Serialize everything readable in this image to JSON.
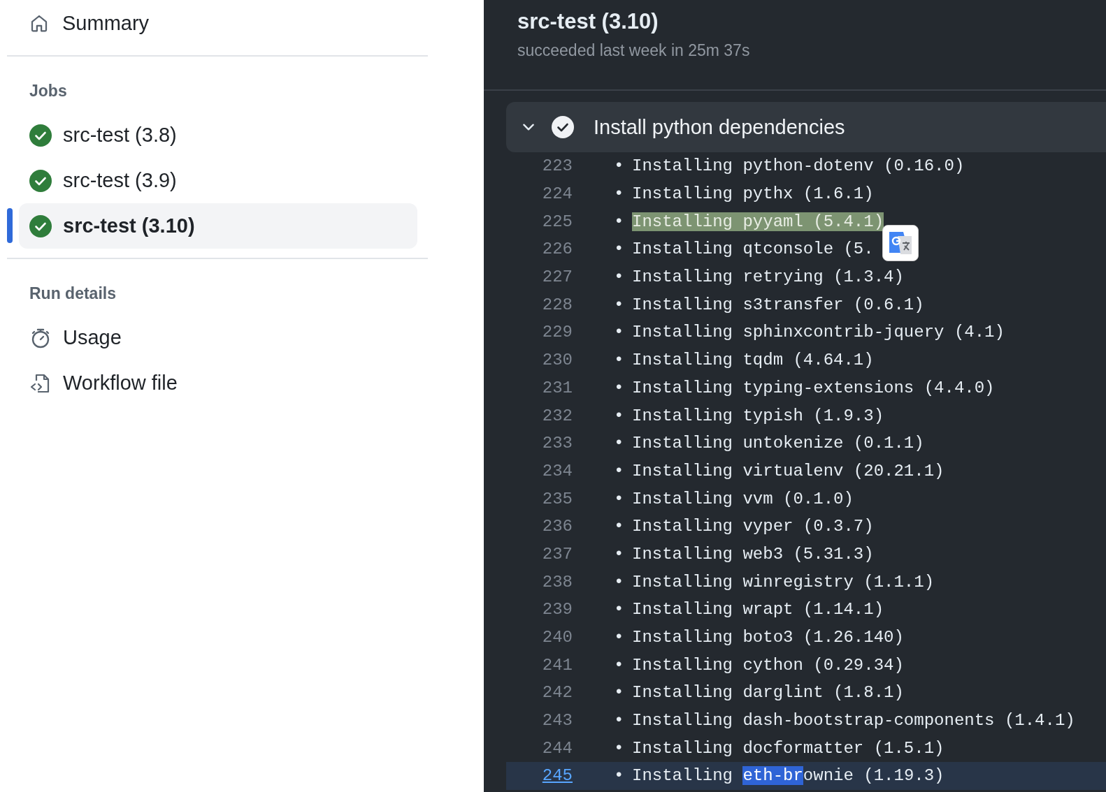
{
  "sidebar": {
    "summary": {
      "label": "Summary"
    },
    "sections": [
      {
        "heading": "Jobs",
        "items": [
          {
            "label": "src-test (3.8)",
            "kind": "job",
            "success": true,
            "selected": false
          },
          {
            "label": "src-test (3.9)",
            "kind": "job",
            "success": true,
            "selected": false
          },
          {
            "label": "src-test (3.10)",
            "kind": "job",
            "success": true,
            "selected": true
          }
        ]
      },
      {
        "heading": "Run details",
        "items": [
          {
            "label": "Usage",
            "kind": "usage",
            "selected": false
          },
          {
            "label": "Workflow file",
            "kind": "workflow",
            "selected": false
          }
        ]
      }
    ]
  },
  "job": {
    "title": "src-test (3.10)",
    "subtitle": "succeeded last week in 25m 37s",
    "step": {
      "title": "Install python dependencies",
      "expanded": true,
      "success": true,
      "lines": [
        {
          "number": "223",
          "bullet": "•",
          "selected": false,
          "segments": [
            {
              "text": "Installing python-dotenv (0.16.0)",
              "match": false,
              "selected": false
            }
          ]
        },
        {
          "number": "224",
          "bullet": "•",
          "selected": false,
          "segments": [
            {
              "text": "Installing pythx (1.6.1)",
              "match": false,
              "selected": false
            }
          ]
        },
        {
          "number": "225",
          "bullet": "•",
          "selected": false,
          "segments": [
            {
              "text": "Installing pyyaml (5.4.1)",
              "match": true,
              "selected": false
            }
          ]
        },
        {
          "number": "226",
          "bullet": "•",
          "selected": false,
          "segments": [
            {
              "text": "Installing qtconsole (5.",
              "match": false,
              "selected": false
            }
          ]
        },
        {
          "number": "227",
          "bullet": "•",
          "selected": false,
          "segments": [
            {
              "text": "Installing retrying (1.3.4)",
              "match": false,
              "selected": false
            }
          ]
        },
        {
          "number": "228",
          "bullet": "•",
          "selected": false,
          "segments": [
            {
              "text": "Installing s3transfer (0.6.1)",
              "match": false,
              "selected": false
            }
          ]
        },
        {
          "number": "229",
          "bullet": "•",
          "selected": false,
          "segments": [
            {
              "text": "Installing sphinxcontrib-jquery (4.1)",
              "match": false,
              "selected": false
            }
          ]
        },
        {
          "number": "230",
          "bullet": "•",
          "selected": false,
          "segments": [
            {
              "text": "Installing tqdm (4.64.1)",
              "match": false,
              "selected": false
            }
          ]
        },
        {
          "number": "231",
          "bullet": "•",
          "selected": false,
          "segments": [
            {
              "text": "Installing typing-extensions (4.4.0)",
              "match": false,
              "selected": false
            }
          ]
        },
        {
          "number": "232",
          "bullet": "•",
          "selected": false,
          "segments": [
            {
              "text": "Installing typish (1.9.3)",
              "match": false,
              "selected": false
            }
          ]
        },
        {
          "number": "233",
          "bullet": "•",
          "selected": false,
          "segments": [
            {
              "text": "Installing untokenize (0.1.1)",
              "match": false,
              "selected": false
            }
          ]
        },
        {
          "number": "234",
          "bullet": "•",
          "selected": false,
          "segments": [
            {
              "text": "Installing virtualenv (20.21.1)",
              "match": false,
              "selected": false
            }
          ]
        },
        {
          "number": "235",
          "bullet": "•",
          "selected": false,
          "segments": [
            {
              "text": "Installing vvm (0.1.0)",
              "match": false,
              "selected": false
            }
          ]
        },
        {
          "number": "236",
          "bullet": "•",
          "selected": false,
          "segments": [
            {
              "text": "Installing vyper (0.3.7)",
              "match": false,
              "selected": false
            }
          ]
        },
        {
          "number": "237",
          "bullet": "•",
          "selected": false,
          "segments": [
            {
              "text": "Installing web3 (5.31.3)",
              "match": false,
              "selected": false
            }
          ]
        },
        {
          "number": "238",
          "bullet": "•",
          "selected": false,
          "segments": [
            {
              "text": "Installing winregistry (1.1.1)",
              "match": false,
              "selected": false
            }
          ]
        },
        {
          "number": "239",
          "bullet": "•",
          "selected": false,
          "segments": [
            {
              "text": "Installing wrapt (1.14.1)",
              "match": false,
              "selected": false
            }
          ]
        },
        {
          "number": "240",
          "bullet": "•",
          "selected": false,
          "segments": [
            {
              "text": "Installing boto3 (1.26.140)",
              "match": false,
              "selected": false
            }
          ]
        },
        {
          "number": "241",
          "bullet": "•",
          "selected": false,
          "segments": [
            {
              "text": "Installing cython (0.29.34)",
              "match": false,
              "selected": false
            }
          ]
        },
        {
          "number": "242",
          "bullet": "•",
          "selected": false,
          "segments": [
            {
              "text": "Installing darglint (1.8.1)",
              "match": false,
              "selected": false
            }
          ]
        },
        {
          "number": "243",
          "bullet": "•",
          "selected": false,
          "segments": [
            {
              "text": "Installing dash-bootstrap-components (1.4.1)",
              "match": false,
              "selected": false
            }
          ]
        },
        {
          "number": "244",
          "bullet": "•",
          "selected": false,
          "segments": [
            {
              "text": "Installing docformatter (1.5.1)",
              "match": false,
              "selected": false
            }
          ]
        },
        {
          "number": "245",
          "bullet": "•",
          "selected": true,
          "segments": [
            {
              "text": "Installing ",
              "match": false,
              "selected": false
            },
            {
              "text": "eth-br",
              "match": false,
              "selected": true
            },
            {
              "text": "ownie (1.19.3)",
              "match": false,
              "selected": false
            }
          ]
        }
      ]
    }
  }
}
